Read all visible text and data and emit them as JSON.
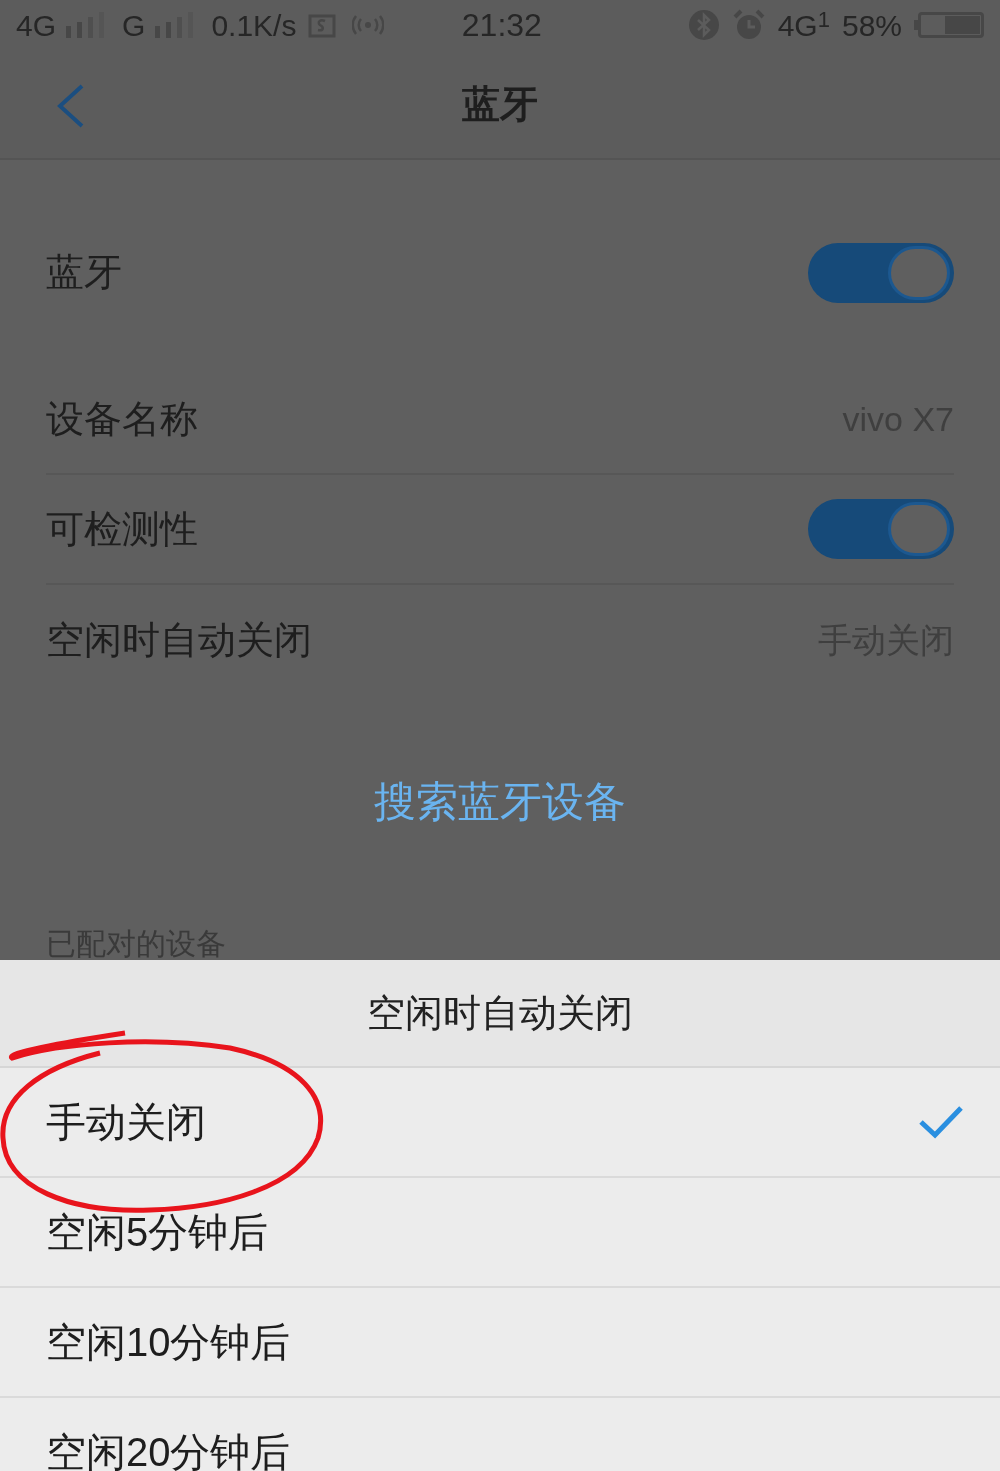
{
  "status_bar": {
    "network_1": "4G",
    "network_2": "G",
    "speed": "0.1K/s",
    "time": "21:32",
    "network_3": "4G",
    "sim_slot": "1",
    "battery": "58%"
  },
  "header": {
    "title": "蓝牙"
  },
  "settings": [
    {
      "kind": "toggle",
      "label": "蓝牙",
      "on": true
    },
    {
      "kind": "value",
      "label": "设备名称",
      "value": "vivo X7"
    },
    {
      "kind": "toggle",
      "label": "可检测性",
      "on": true
    },
    {
      "kind": "value",
      "label": "空闲时自动关闭",
      "value": "手动关闭"
    }
  ],
  "search_button": "搜索蓝牙设备",
  "section_header": "已配对的设备",
  "sheet": {
    "title": "空闲时自动关闭",
    "options": [
      {
        "label": "手动关闭",
        "selected": true
      },
      {
        "label": "空闲5分钟后",
        "selected": false
      },
      {
        "label": "空闲10分钟后",
        "selected": false
      },
      {
        "label": "空闲20分钟后",
        "selected": false
      }
    ]
  }
}
